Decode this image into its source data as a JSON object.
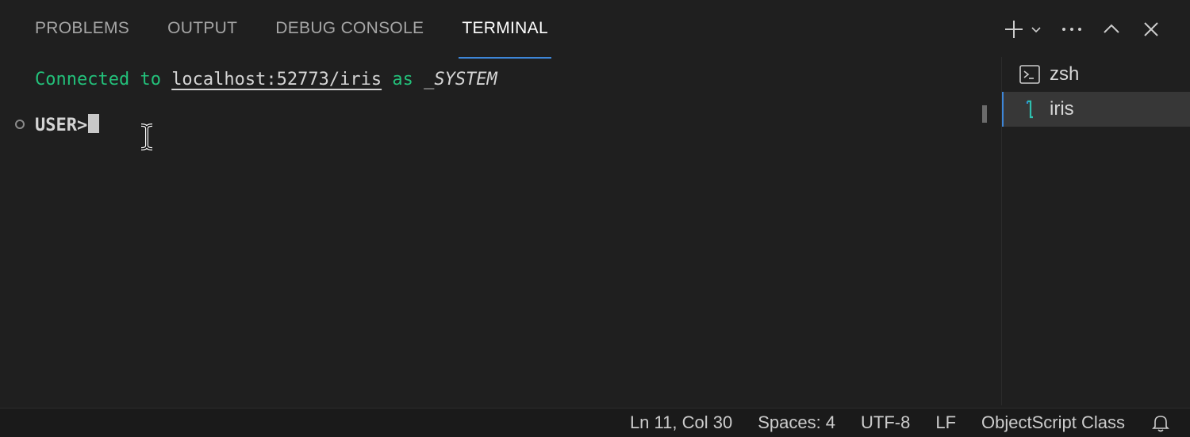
{
  "tabs": [
    {
      "label": "PROBLEMS",
      "active": false
    },
    {
      "label": "OUTPUT",
      "active": false
    },
    {
      "label": "DEBUG CONSOLE",
      "active": false
    },
    {
      "label": "TERMINAL",
      "active": true
    }
  ],
  "actions": {
    "new_terminal_icon": "plus-icon",
    "dropdown_icon": "chevron-down-icon",
    "more_icon": "ellipsis-icon",
    "maximize_icon": "chevron-up-icon",
    "close_icon": "close-icon"
  },
  "terminal": {
    "line1": {
      "prefix": "Connected to ",
      "host": "localhost:52773/iris",
      "middle": " as ",
      "user": "_SYSTEM"
    },
    "prompt": "USER>"
  },
  "terminal_list": [
    {
      "label": "zsh",
      "icon": "terminal-icon",
      "selected": false
    },
    {
      "label": "iris",
      "icon": "iris-icon",
      "selected": true
    }
  ],
  "status_bar": {
    "position": "Ln 11, Col 30",
    "spaces": "Spaces: 4",
    "encoding": "UTF-8",
    "eol": "LF",
    "language": "ObjectScript Class",
    "bell_icon": "bell-icon"
  },
  "colors": {
    "background": "#1f1f1f",
    "accent": "#3d86d8",
    "green": "#23c07a"
  }
}
